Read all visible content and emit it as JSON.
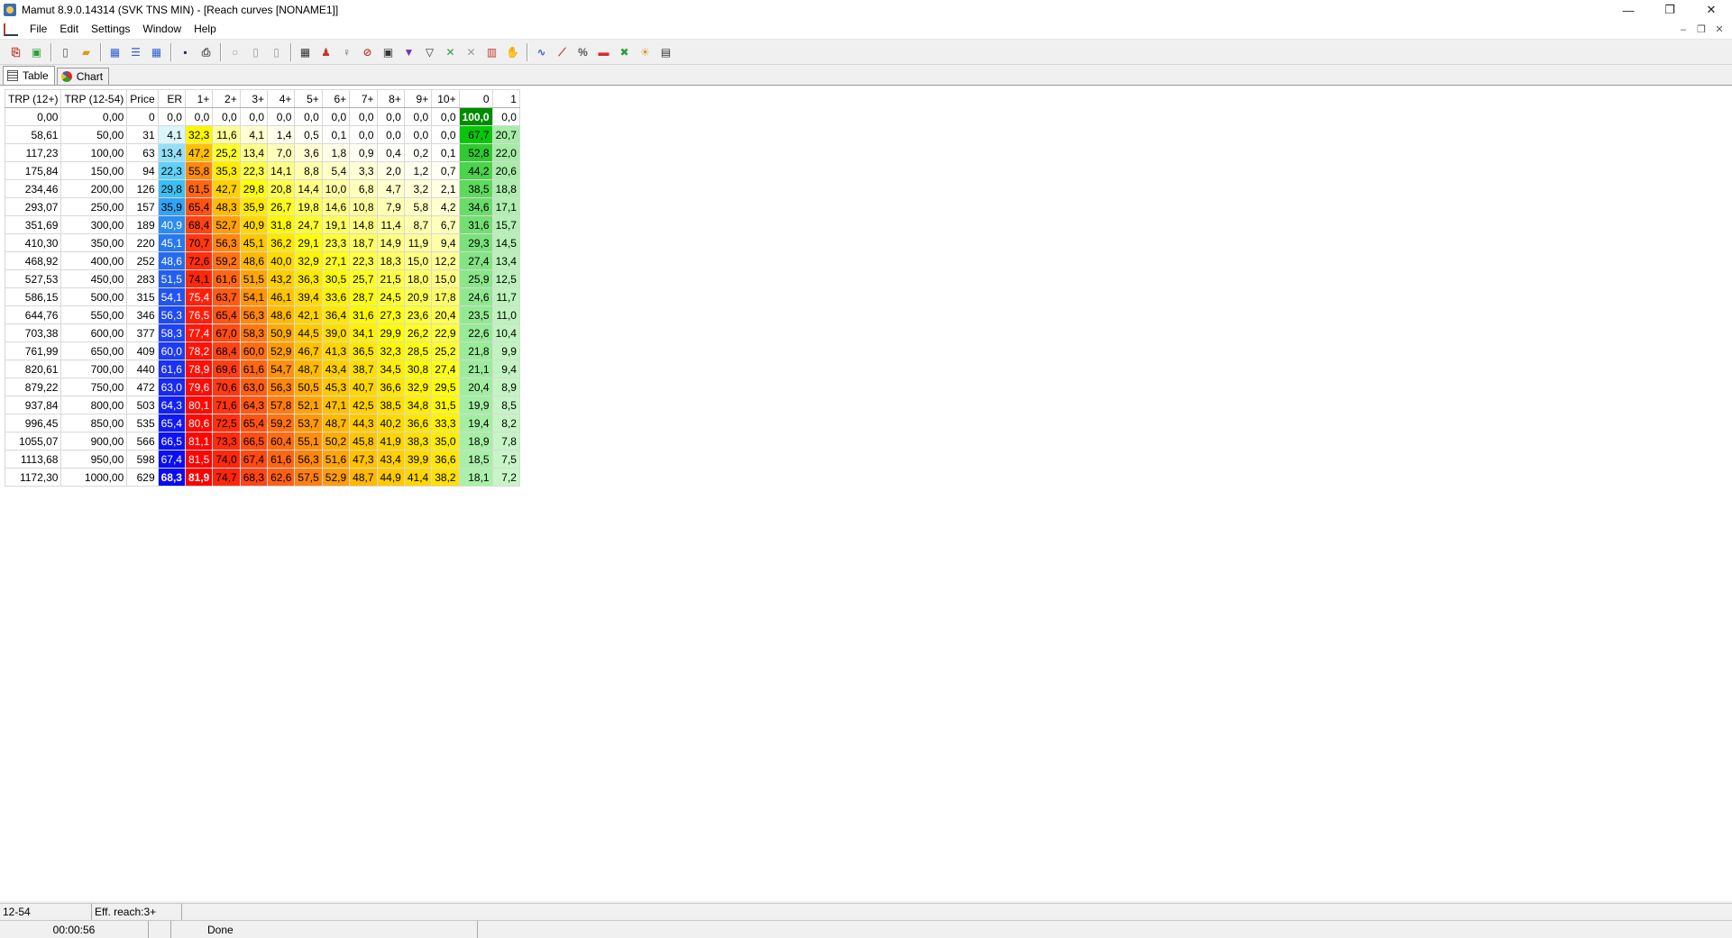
{
  "window": {
    "title": "Mamut 8.9.0.14314 (SVK TNS MIN) - [Reach curves [NONAME1]]"
  },
  "menu": [
    "File",
    "Edit",
    "Settings",
    "Window",
    "Help"
  ],
  "toolbar_groups": [
    [
      {
        "name": "copy-icon",
        "color": "#c0392b",
        "glyph": "⎘"
      },
      {
        "name": "paste-icon",
        "color": "#2e9e3a",
        "glyph": "▣"
      }
    ],
    [
      {
        "name": "new-document-icon",
        "color": "#555555",
        "glyph": "▯"
      },
      {
        "name": "open-folder-icon",
        "color": "#d4a017",
        "glyph": "▰"
      }
    ],
    [
      {
        "name": "table-view-icon",
        "color": "#2f5fd0",
        "glyph": "▦"
      },
      {
        "name": "list-view-icon",
        "color": "#2f5fd0",
        "glyph": "☰"
      },
      {
        "name": "grid-view-icon",
        "color": "#2f5fd0",
        "glyph": "▦"
      }
    ],
    [
      {
        "name": "save-icon",
        "color": "#1f2d5c",
        "glyph": "▪"
      },
      {
        "name": "print-icon",
        "color": "#555555",
        "glyph": "⎙"
      }
    ],
    [
      {
        "name": "circle-icon",
        "color": "#9a9a9a",
        "glyph": "○"
      },
      {
        "name": "document-gray-icon",
        "color": "#9a9a9a",
        "glyph": "▯"
      },
      {
        "name": "documents-gray-icon",
        "color": "#9a9a9a",
        "glyph": "▯"
      }
    ],
    [
      {
        "name": "spreadsheet-icon",
        "color": "#333333",
        "glyph": "▦"
      },
      {
        "name": "people-icon",
        "color": "#c0392b",
        "glyph": "♟"
      },
      {
        "name": "bulb-small-icon",
        "color": "#555555",
        "glyph": "♀"
      },
      {
        "name": "no-people-icon",
        "color": "#c0392b",
        "glyph": "⊘"
      },
      {
        "name": "tv-icon",
        "color": "#333333",
        "glyph": "▣"
      },
      {
        "name": "filter-icon",
        "color": "#7b2fb0",
        "glyph": "▼"
      },
      {
        "name": "filter-outline-icon",
        "color": "#333333",
        "glyph": "▽"
      },
      {
        "name": "excel-x-icon",
        "color": "#2e9e3a",
        "glyph": "✕"
      },
      {
        "name": "delete-x-icon",
        "color": "#9a9a9a",
        "glyph": "✕"
      },
      {
        "name": "calendar-icon",
        "color": "#c0392b",
        "glyph": "▥"
      },
      {
        "name": "hand-icon",
        "color": "#9a9a9a",
        "glyph": "✋"
      }
    ],
    [
      {
        "name": "curve-icon",
        "color": "#2f5fd0",
        "glyph": "∿"
      },
      {
        "name": "line-chart-icon",
        "color": "#c0392b",
        "glyph": "⟋"
      },
      {
        "name": "percent-icon",
        "color": "#555555",
        "glyph": "%"
      },
      {
        "name": "color-bar-icon",
        "color": "#d62c2c",
        "glyph": "▬"
      },
      {
        "name": "excel-icon",
        "color": "#2e9e3a",
        "glyph": "✖"
      },
      {
        "name": "lightbulb-icon",
        "color": "#d4a017",
        "glyph": "☀"
      },
      {
        "name": "calculator-icon",
        "color": "#333333",
        "glyph": "▤"
      }
    ]
  ],
  "view_tabs": [
    {
      "label": "Table",
      "icon": "table-icon",
      "active": true
    },
    {
      "label": "Chart",
      "icon": "chart-icon",
      "active": false
    }
  ],
  "reach_table": {
    "columns": [
      "TRP (12+)",
      "TRP (12-54)",
      "Price",
      "ER",
      "1+",
      "2+",
      "3+",
      "4+",
      "5+",
      "6+",
      "7+",
      "8+",
      "9+",
      "10+",
      "0",
      "1"
    ],
    "rows": [
      [
        "0,00",
        "0,00",
        "0",
        "0,0",
        "0,0",
        "0,0",
        "0,0",
        "0,0",
        "0,0",
        "0,0",
        "0,0",
        "0,0",
        "0,0",
        "0,0",
        "100,0",
        "0,0"
      ],
      [
        "58,61",
        "50,00",
        "31",
        "4,1",
        "32,3",
        "11,6",
        "4,1",
        "1,4",
        "0,5",
        "0,1",
        "0,0",
        "0,0",
        "0,0",
        "0,0",
        "67,7",
        "20,7"
      ],
      [
        "117,23",
        "100,00",
        "63",
        "13,4",
        "47,2",
        "25,2",
        "13,4",
        "7,0",
        "3,6",
        "1,8",
        "0,9",
        "0,4",
        "0,2",
        "0,1",
        "52,8",
        "22,0"
      ],
      [
        "175,84",
        "150,00",
        "94",
        "22,3",
        "55,8",
        "35,3",
        "22,3",
        "14,1",
        "8,8",
        "5,4",
        "3,3",
        "2,0",
        "1,2",
        "0,7",
        "44,2",
        "20,6"
      ],
      [
        "234,46",
        "200,00",
        "126",
        "29,8",
        "61,5",
        "42,7",
        "29,8",
        "20,8",
        "14,4",
        "10,0",
        "6,8",
        "4,7",
        "3,2",
        "2,1",
        "38,5",
        "18,8"
      ],
      [
        "293,07",
        "250,00",
        "157",
        "35,9",
        "65,4",
        "48,3",
        "35,9",
        "26,7",
        "19,8",
        "14,6",
        "10,8",
        "7,9",
        "5,8",
        "4,2",
        "34,6",
        "17,1"
      ],
      [
        "351,69",
        "300,00",
        "189",
        "40,9",
        "68,4",
        "52,7",
        "40,9",
        "31,8",
        "24,7",
        "19,1",
        "14,8",
        "11,4",
        "8,7",
        "6,7",
        "31,6",
        "15,7"
      ],
      [
        "410,30",
        "350,00",
        "220",
        "45,1",
        "70,7",
        "56,3",
        "45,1",
        "36,2",
        "29,1",
        "23,3",
        "18,7",
        "14,9",
        "11,9",
        "9,4",
        "29,3",
        "14,5"
      ],
      [
        "468,92",
        "400,00",
        "252",
        "48,6",
        "72,6",
        "59,2",
        "48,6",
        "40,0",
        "32,9",
        "27,1",
        "22,3",
        "18,3",
        "15,0",
        "12,2",
        "27,4",
        "13,4"
      ],
      [
        "527,53",
        "450,00",
        "283",
        "51,5",
        "74,1",
        "61,6",
        "51,5",
        "43,2",
        "36,3",
        "30,5",
        "25,7",
        "21,5",
        "18,0",
        "15,0",
        "25,9",
        "12,5"
      ],
      [
        "586,15",
        "500,00",
        "315",
        "54,1",
        "75,4",
        "63,7",
        "54,1",
        "46,1",
        "39,4",
        "33,6",
        "28,7",
        "24,5",
        "20,9",
        "17,8",
        "24,6",
        "11,7"
      ],
      [
        "644,76",
        "550,00",
        "346",
        "56,3",
        "76,5",
        "65,4",
        "56,3",
        "48,6",
        "42,1",
        "36,4",
        "31,6",
        "27,3",
        "23,6",
        "20,4",
        "23,5",
        "11,0"
      ],
      [
        "703,38",
        "600,00",
        "377",
        "58,3",
        "77,4",
        "67,0",
        "58,3",
        "50,9",
        "44,5",
        "39,0",
        "34,1",
        "29,9",
        "26,2",
        "22,9",
        "22,6",
        "10,4"
      ],
      [
        "761,99",
        "650,00",
        "409",
        "60,0",
        "78,2",
        "68,4",
        "60,0",
        "52,9",
        "46,7",
        "41,3",
        "36,5",
        "32,3",
        "28,5",
        "25,2",
        "21,8",
        "9,9"
      ],
      [
        "820,61",
        "700,00",
        "440",
        "61,6",
        "78,9",
        "69,6",
        "61,6",
        "54,7",
        "48,7",
        "43,4",
        "38,7",
        "34,5",
        "30,8",
        "27,4",
        "21,1",
        "9,4"
      ],
      [
        "879,22",
        "750,00",
        "472",
        "63,0",
        "79,6",
        "70,6",
        "63,0",
        "56,3",
        "50,5",
        "45,3",
        "40,7",
        "36,6",
        "32,9",
        "29,5",
        "20,4",
        "8,9"
      ],
      [
        "937,84",
        "800,00",
        "503",
        "64,3",
        "80,1",
        "71,6",
        "64,3",
        "57,8",
        "52,1",
        "47,1",
        "42,5",
        "38,5",
        "34,8",
        "31,5",
        "19,9",
        "8,5"
      ],
      [
        "996,45",
        "850,00",
        "535",
        "65,4",
        "80,6",
        "72,5",
        "65,4",
        "59,2",
        "53,7",
        "48,7",
        "44,3",
        "40,2",
        "36,6",
        "33,3",
        "19,4",
        "8,2"
      ],
      [
        "1055,07",
        "900,00",
        "566",
        "66,5",
        "81,1",
        "73,3",
        "66,5",
        "60,4",
        "55,1",
        "50,2",
        "45,8",
        "41,9",
        "38,3",
        "35,0",
        "18,9",
        "7,8"
      ],
      [
        "1113,68",
        "950,00",
        "598",
        "67,4",
        "81,5",
        "74,0",
        "67,4",
        "61,6",
        "56,3",
        "51,6",
        "47,3",
        "43,4",
        "39,9",
        "36,6",
        "18,5",
        "7,5"
      ],
      [
        "1172,30",
        "1000,00",
        "629",
        "68,3",
        "81,9",
        "74,7",
        "68,3",
        "62,6",
        "57,5",
        "52,9",
        "48,7",
        "44,9",
        "41,4",
        "38,2",
        "18,1",
        "7,2"
      ]
    ]
  },
  "status": {
    "target": "12-54",
    "eff_reach": "Eff. reach:3+",
    "elapsed": "00:00:56",
    "state": "Done"
  }
}
